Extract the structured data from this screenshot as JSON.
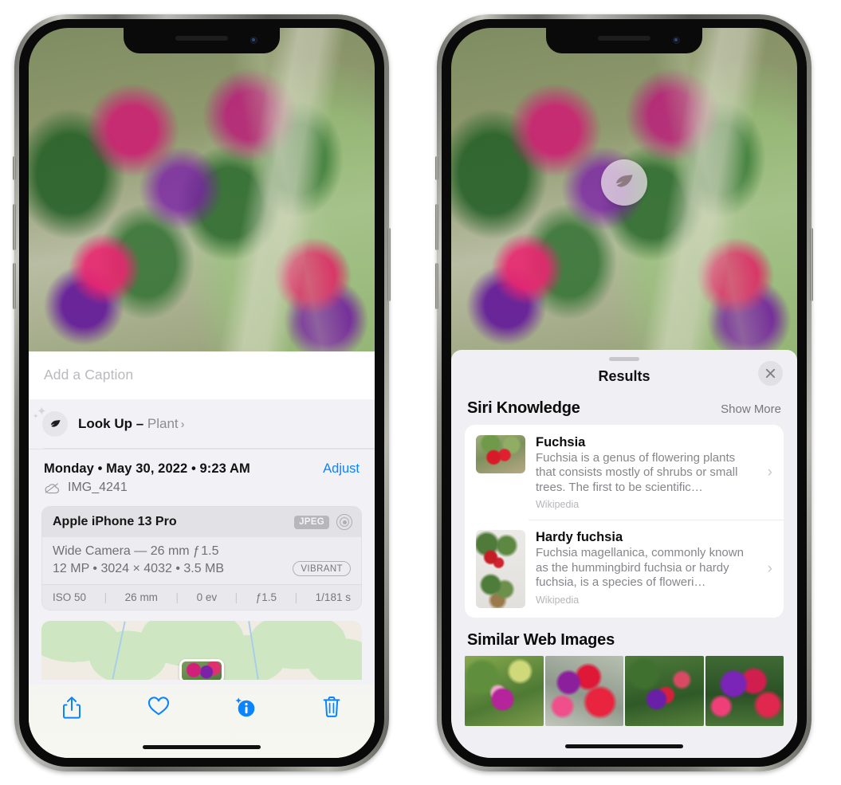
{
  "left_phone": {
    "caption": {
      "placeholder": "Add a Caption",
      "value": ""
    },
    "look_up": {
      "label_action": "Look Up",
      "dash": " – ",
      "subject": "Plant",
      "chevron": "›",
      "icon": "leaf-icon"
    },
    "date_row": {
      "datetime": "Monday • May 30, 2022 • 9:23 AM",
      "adjust_label": "Adjust"
    },
    "file_row": {
      "filename": "IMG_4241",
      "icon": "icloud-slash-icon"
    },
    "camera_card": {
      "device": "Apple iPhone 13 Pro",
      "format_badge": "JPEG",
      "aperture_icon": "aperture-icon",
      "lens_line": "Wide Camera — 26 mm ƒ 1.5",
      "specs_line": "12 MP • 3024 × 4032 • 3.5 MB",
      "style_badge": "VIBRANT",
      "exif": [
        {
          "label": "ISO 50"
        },
        {
          "label": "26 mm"
        },
        {
          "label": "0 ev"
        },
        {
          "label": "ƒ1.5"
        },
        {
          "label": "1/181 s"
        }
      ],
      "exif_separator": "|"
    },
    "toolbar": [
      {
        "name": "share-button",
        "icon": "share-icon"
      },
      {
        "name": "favorite-button",
        "icon": "heart-icon"
      },
      {
        "name": "info-button",
        "icon": "info-sparkle-icon"
      },
      {
        "name": "delete-button",
        "icon": "trash-icon"
      }
    ],
    "colors": {
      "accent_blue": "#0a84ff",
      "sheet_bg": "#f2f2f6"
    }
  },
  "right_phone": {
    "visual_lookup_badge": {
      "icon": "leaf-icon"
    },
    "sheet": {
      "title": "Results",
      "close_icon": "close-icon",
      "sections": [
        {
          "title": "Siri Knowledge",
          "action_label": "Show More",
          "items": [
            {
              "title": "Fuchsia",
              "description": "Fuchsia is a genus of flowering plants that consists mostly of shrubs or small trees. The first to be scientific…",
              "source": "Wikipedia",
              "chevron": "›"
            },
            {
              "title": "Hardy fuchsia",
              "description": "Fuchsia magellanica, commonly known as the hummingbird fuchsia or hardy fuchsia, is a species of floweri…",
              "source": "Wikipedia",
              "chevron": "›"
            }
          ]
        },
        {
          "title": "Similar Web Images",
          "items": [
            {
              "name": "web-image-1"
            },
            {
              "name": "web-image-2"
            },
            {
              "name": "web-image-3"
            },
            {
              "name": "web-image-4"
            }
          ]
        }
      ]
    },
    "colors": {
      "sheet_bg": "#f0eff4",
      "card_bg": "#ffffff"
    }
  }
}
